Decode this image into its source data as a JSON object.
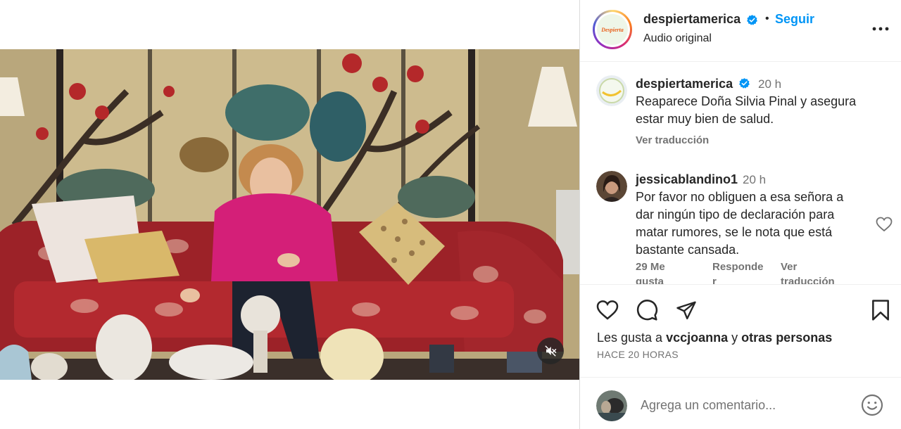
{
  "post": {
    "username": "despiertamerica",
    "follow_label": "Seguir",
    "separator": "•",
    "audio_label": "Audio original",
    "avatar_logo_text": "Despierta"
  },
  "caption": {
    "username": "despiertamerica",
    "time": "20 h",
    "text_line1": "Reaparece Doña Silvia Pinal y asegura",
    "text_line2": "estar muy bien de salud.",
    "translate_label": "Ver traducción"
  },
  "comment": {
    "username": "jessicablandino1",
    "time": "20 h",
    "text_line1": "Por favor no obliguen a esa señora a",
    "text_line2": "dar ningún tipo de declaración para",
    "text_line3": "matar rumores, se le nota que está",
    "text_line4": "bastante cansada.",
    "likes_line1": "29 Me",
    "likes_line2": "gusta",
    "reply_line1": "Responde",
    "reply_line2": "r",
    "translate_line1": "Ver",
    "translate_line2": "traducción"
  },
  "engagement": {
    "likes_prefix": "Les gusta a",
    "liker": "vccjoanna",
    "conjunction": "y",
    "others": "otras personas",
    "time_ago": "HACE 20 HORAS"
  },
  "add_comment": {
    "placeholder": "Agrega un comentario..."
  },
  "icons": {
    "verified": "verified-badge-icon",
    "more": "more-options-icon",
    "like": "heart-icon",
    "comment": "comment-icon",
    "share": "share-icon",
    "save": "bookmark-icon",
    "mute": "muted-speaker-icon",
    "emoji": "emoji-icon"
  },
  "colors": {
    "accent": "#0095f6",
    "verified": "#0095f6",
    "text": "#262626",
    "muted": "#737373",
    "border": "#dbdbdb"
  }
}
